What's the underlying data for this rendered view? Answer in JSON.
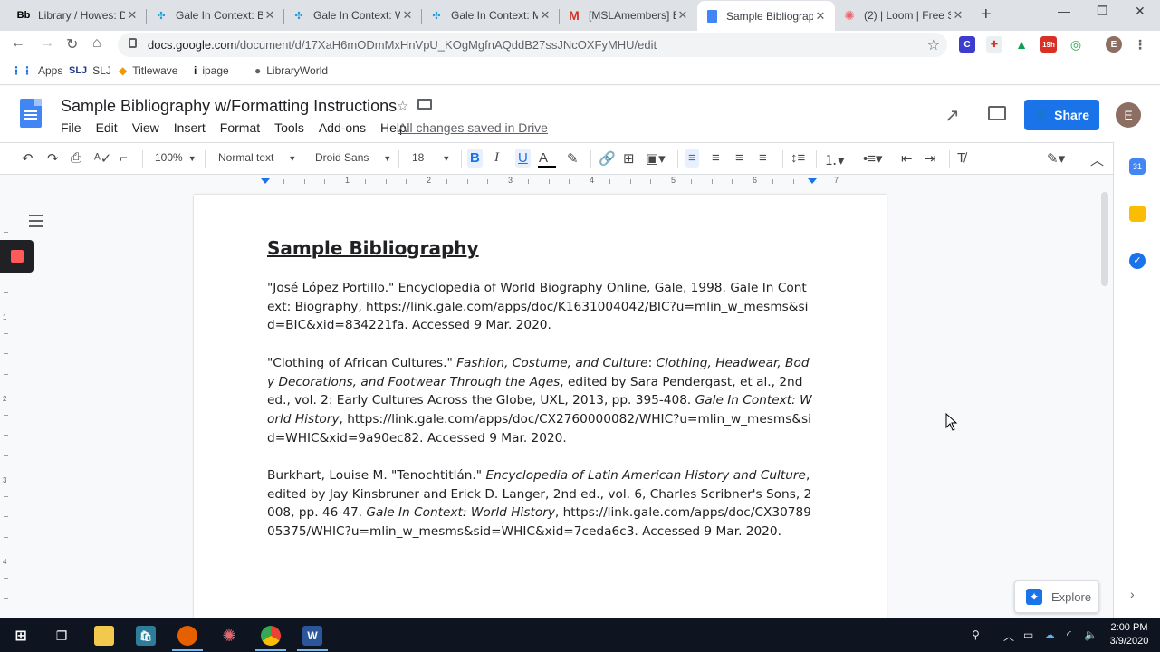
{
  "browser": {
    "tabs": [
      {
        "favicon": "Bb",
        "title": "Library / Howes: D",
        "active": false
      },
      {
        "favicon": "gale",
        "title": "Gale In Context: B",
        "active": false
      },
      {
        "favicon": "gale",
        "title": "Gale In Context: W",
        "active": false
      },
      {
        "favicon": "gale",
        "title": "Gale In Context: M",
        "active": false
      },
      {
        "favicon": "gmail",
        "title": "[MSLAmembers] E",
        "active": false
      },
      {
        "favicon": "docs",
        "title": "Sample Bibliograp",
        "active": true
      },
      {
        "favicon": "loom",
        "title": "(2) | Loom | Free S",
        "active": false
      }
    ],
    "url_host": "docs.google.com",
    "url_path": "/document/d/17XaH6mODmMxHnVpU_KOgMgfnAQddB27ssJNcOXFyMHU/edit",
    "bookmarks": [
      {
        "icon": "apps-grid-icon",
        "label": "Apps"
      },
      {
        "icon": "slj-icon",
        "label": "SLJ"
      },
      {
        "icon": "titlewave-icon",
        "label": "Titlewave"
      },
      {
        "icon": "ipage-icon",
        "label": "ipage"
      },
      {
        "icon": "libraryworld-icon",
        "label": "LibraryWorld"
      }
    ],
    "extension_badge": "19h"
  },
  "docs": {
    "title": "Sample Bibliography w/Formatting Instructions",
    "menu": [
      "File",
      "Edit",
      "View",
      "Insert",
      "Format",
      "Tools",
      "Add-ons",
      "Help"
    ],
    "save_status": "All changes saved in Drive",
    "share_label": "Share",
    "avatar_letter": "E",
    "toolbar": {
      "zoom": "100%",
      "style": "Normal text",
      "font": "Droid Sans",
      "size": "18"
    },
    "ruler_numbers": [
      "1",
      "2",
      "3",
      "4",
      "5",
      "6",
      "7"
    ],
    "vruler_numbers": [
      "1",
      "2",
      "3",
      "4"
    ],
    "explore_label": "Explore"
  },
  "document": {
    "heading": "Sample Bibliography",
    "entries": [
      {
        "parts": [
          {
            "text": "\"José López Portillo.\" Encyclopedia of World Biography Online, Gale, 1998. Gale In Context: Biography, https://link.gale.com/apps/doc/K1631004042/BIC?u=mlin_w_mesms&sid=BIC&xid=834221fa. Accessed 9 Mar. 2020.",
            "italic": false
          }
        ]
      },
      {
        "parts": [
          {
            "text": "\"Clothing of African Cultures.\" ",
            "italic": false
          },
          {
            "text": "Fashion, Costume, and Culture",
            "italic": true
          },
          {
            "text": ": ",
            "italic": false
          },
          {
            "text": "Clothing, Headwear, Body Decorations, and Footwear Through the Ages",
            "italic": true
          },
          {
            "text": ", edited by Sara Pendergast, et al., 2nd ed., vol. 2: Early Cultures Across the Globe, UXL, 2013, pp. 395-408. ",
            "italic": false
          },
          {
            "text": "Gale In Context: World History",
            "italic": true
          },
          {
            "text": ", https://link.gale.com/apps/doc/CX2760000082/WHIC?u=mlin_w_mesms&sid=WHIC&xid=9a90ec82. Accessed 9 Mar. 2020.",
            "italic": false
          }
        ]
      },
      {
        "parts": [
          {
            "text": "Burkhart, Louise M. \"Tenochtitlán.\" ",
            "italic": false
          },
          {
            "text": "Encyclopedia of Latin American History and Culture",
            "italic": true
          },
          {
            "text": ", edited by Jay Kinsbruner and Erick D. Langer, 2nd ed., vol. 6, Charles Scribner's Sons, 2008, pp. 46-47. ",
            "italic": false
          },
          {
            "text": "Gale In Context: World History",
            "italic": true
          },
          {
            "text": ", https://link.gale.com/apps/doc/CX3078905375/WHIC?u=mlin_w_mesms&sid=WHIC&xid=7ceda6c3. Accessed 9 Mar. 2020.",
            "italic": false
          }
        ]
      }
    ]
  },
  "taskbar": {
    "time": "2:00 PM",
    "date": "3/9/2020"
  },
  "colors": {
    "accent": "#1a73e8",
    "docs_blue": "#4285f4",
    "loom_red": "#ff5a5a"
  }
}
